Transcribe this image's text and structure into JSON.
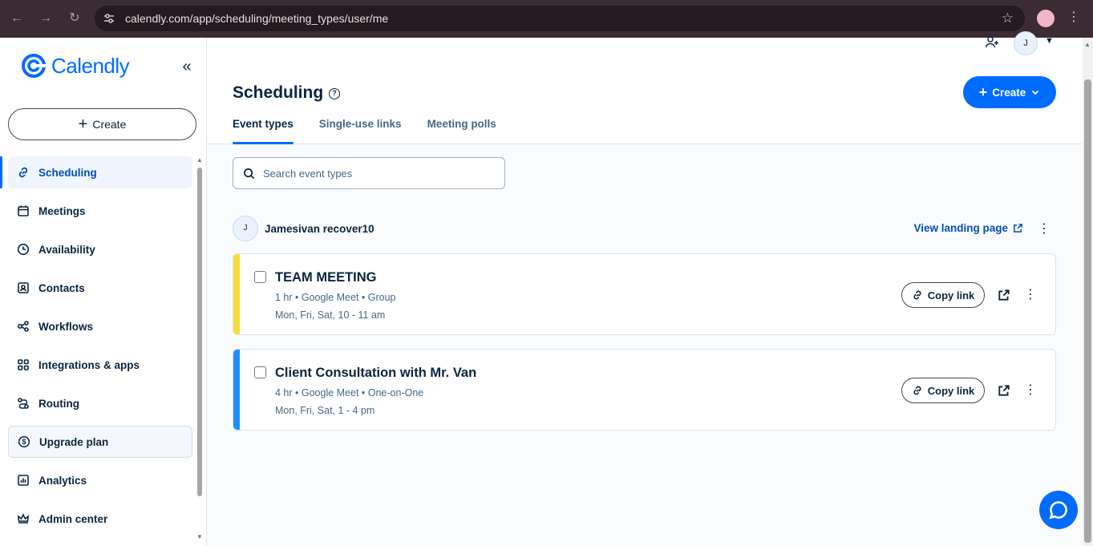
{
  "browser": {
    "url": "calendly.com/app/scheduling/meeting_types/user/me"
  },
  "brand": {
    "name": "Calendly",
    "accent": "#006bff"
  },
  "sidebar": {
    "create_label": "Create",
    "items": [
      {
        "label": "Scheduling",
        "icon": "link-icon",
        "active": true
      },
      {
        "label": "Meetings",
        "icon": "calendar-icon"
      },
      {
        "label": "Availability",
        "icon": "clock-icon"
      },
      {
        "label": "Contacts",
        "icon": "contact-card-icon"
      },
      {
        "label": "Workflows",
        "icon": "workflow-icon"
      },
      {
        "label": "Integrations & apps",
        "icon": "grid-icon"
      },
      {
        "label": "Routing",
        "icon": "routing-icon"
      },
      {
        "label": "Upgrade plan",
        "icon": "dollar-icon"
      },
      {
        "label": "Analytics",
        "icon": "bar-chart-icon"
      },
      {
        "label": "Admin center",
        "icon": "crown-icon"
      }
    ]
  },
  "header": {
    "avatar_initial": "J",
    "title": "Scheduling",
    "create_label": "Create",
    "tabs": [
      {
        "label": "Event types",
        "active": true
      },
      {
        "label": "Single-use links"
      },
      {
        "label": "Meeting polls"
      }
    ]
  },
  "search": {
    "placeholder": "Search event types",
    "value": ""
  },
  "user": {
    "initial": "J",
    "name": "Jamesivan recover10",
    "landing_label": "View landing page"
  },
  "events": [
    {
      "title": "TEAM MEETING",
      "meta": "1 hr • Google Meet • Group",
      "schedule": "Mon, Fri, Sat, 10 - 11 am",
      "color": "#f5de3c",
      "copy_label": "Copy link"
    },
    {
      "title": "Client Consultation with Mr. Van",
      "meta": "4 hr • Google Meet • One-on-One",
      "schedule": "Mon, Fri, Sat, 1 - 4 pm",
      "color": "#1e8fff",
      "copy_label": "Copy link"
    }
  ]
}
